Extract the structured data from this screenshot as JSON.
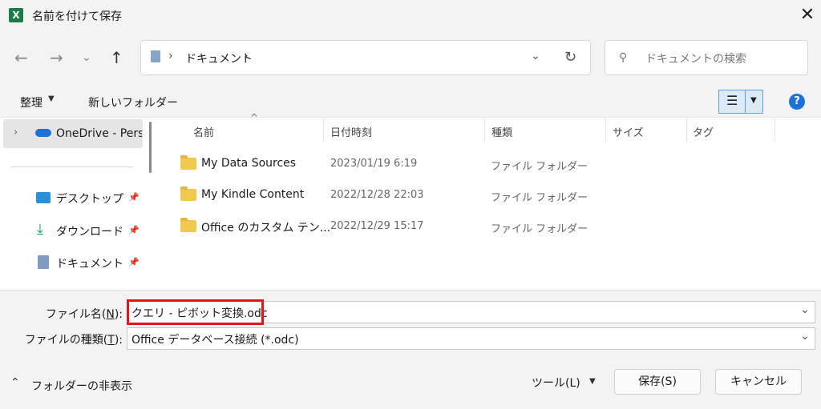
{
  "window": {
    "title": "名前を付けて保存",
    "app_icon": "excel-icon",
    "close_icon": "close-icon"
  },
  "nav": {
    "breadcrumb_sep": "›",
    "location": "ドキュメント",
    "location_sep": "›",
    "search_placeholder": "ドキュメントの検索"
  },
  "toolbar": {
    "organize": "整理",
    "new_folder": "新しいフォルダー"
  },
  "sidebar": {
    "top_item": "OneDrive - Perso",
    "items": [
      {
        "label": "デスクトップ",
        "icon": "desktop-icon"
      },
      {
        "label": "ダウンロード",
        "icon": "download-icon"
      },
      {
        "label": "ドキュメント",
        "icon": "documents-icon"
      }
    ]
  },
  "columns": [
    "名前",
    "日付時刻",
    "種類",
    "サイズ",
    "タグ"
  ],
  "files": [
    {
      "name": "My Data Sources",
      "date": "2023/01/19 6:19",
      "type": "ファイル フォルダー",
      "icon": "data-sources-folder-icon"
    },
    {
      "name": "My Kindle Content",
      "date": "2022/12/28 22:03",
      "type": "ファイル フォルダー",
      "icon": "folder-icon"
    },
    {
      "name": "Office のカスタム テン...",
      "date": "2022/12/29 15:17",
      "type": "ファイル フォルダー",
      "icon": "folder-icon"
    }
  ],
  "form": {
    "filename_label_pre": "ファイル名(",
    "filename_label_key": "N",
    "filename_label_post": "):",
    "filename_value": "クエリ - ピボット変換.odc",
    "filetype_label_pre": "ファイルの種類(",
    "filetype_label_key": "T",
    "filetype_label_post": "):",
    "filetype_value": "Office データベース接続 (*.odc)"
  },
  "footer": {
    "hide_folders": "フォルダーの非表示",
    "tools": "ツール(L)",
    "save": "保存(S)",
    "cancel": "キャンセル"
  },
  "colors": {
    "highlight": "#e0161c",
    "accent": "#1e72d4"
  }
}
